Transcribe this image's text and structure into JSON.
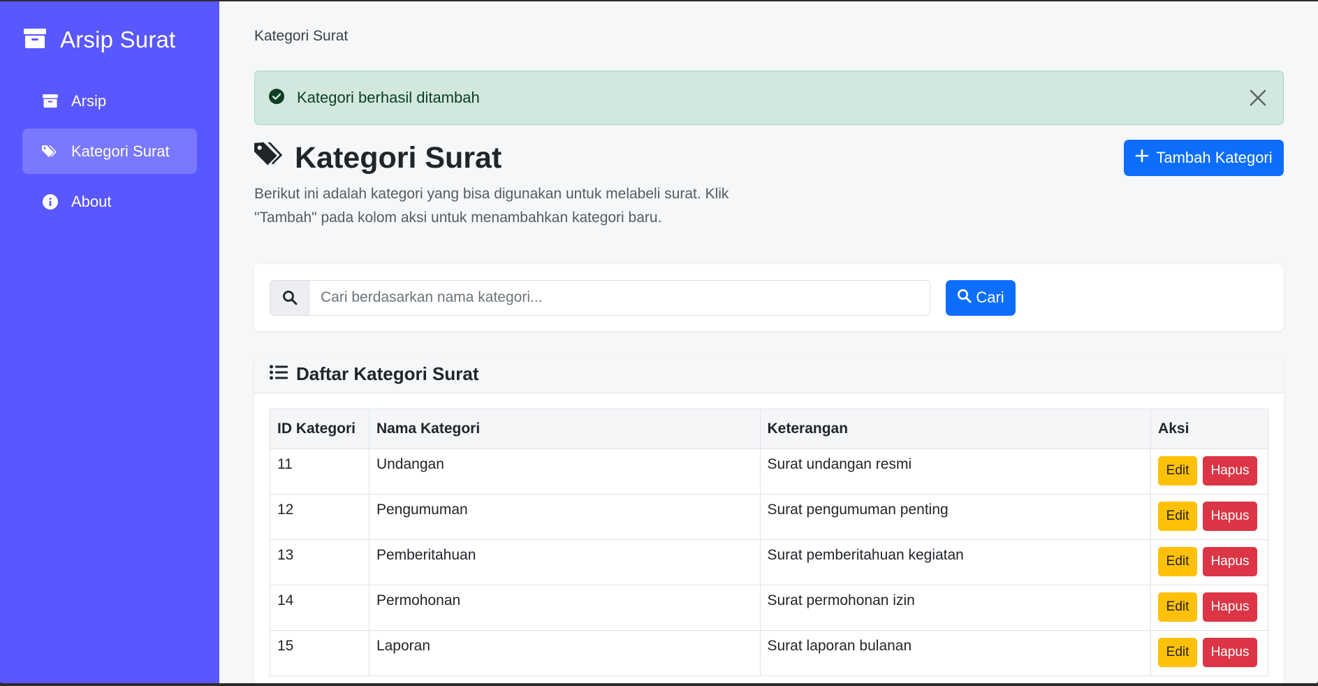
{
  "sidebar": {
    "brand": "Arsip Surat",
    "items": [
      {
        "label": "Arsip",
        "icon": "archive-icon",
        "active": false
      },
      {
        "label": "Kategori Surat",
        "icon": "tags-icon",
        "active": true
      },
      {
        "label": "About",
        "icon": "info-icon",
        "active": false
      }
    ]
  },
  "breadcrumb": "Kategori Surat",
  "alert": {
    "text": "Kategori berhasil ditambah",
    "icon": "check-circle-icon"
  },
  "page": {
    "title": "Kategori Surat",
    "description": "Berikut ini adalah kategori yang bisa digunakan untuk melabeli surat. Klik \"Tambah\" pada kolom aksi untuk menambahkan kategori baru.",
    "add_button": "Tambah Kategori"
  },
  "search": {
    "placeholder": "Cari berdasarkan nama kategori...",
    "value": "",
    "button": "Cari"
  },
  "list": {
    "title": "Daftar Kategori Surat",
    "columns": [
      "ID Kategori",
      "Nama Kategori",
      "Keterangan",
      "Aksi"
    ],
    "rows": [
      {
        "id": "11",
        "name": "Undangan",
        "desc": "Surat undangan resmi"
      },
      {
        "id": "12",
        "name": "Pengumuman",
        "desc": "Surat pengumuman penting"
      },
      {
        "id": "13",
        "name": "Pemberitahuan",
        "desc": "Surat pemberitahuan kegiatan"
      },
      {
        "id": "14",
        "name": "Permohonan",
        "desc": "Surat permohonan izin"
      },
      {
        "id": "15",
        "name": "Laporan",
        "desc": "Surat laporan bulanan"
      }
    ],
    "edit_label": "Edit",
    "delete_label": "Hapus"
  },
  "colors": {
    "sidebar": "#5957ff",
    "primary": "#0d6efd",
    "warning": "#ffc107",
    "danger": "#dc3545",
    "success_bg": "#d2e8df"
  }
}
